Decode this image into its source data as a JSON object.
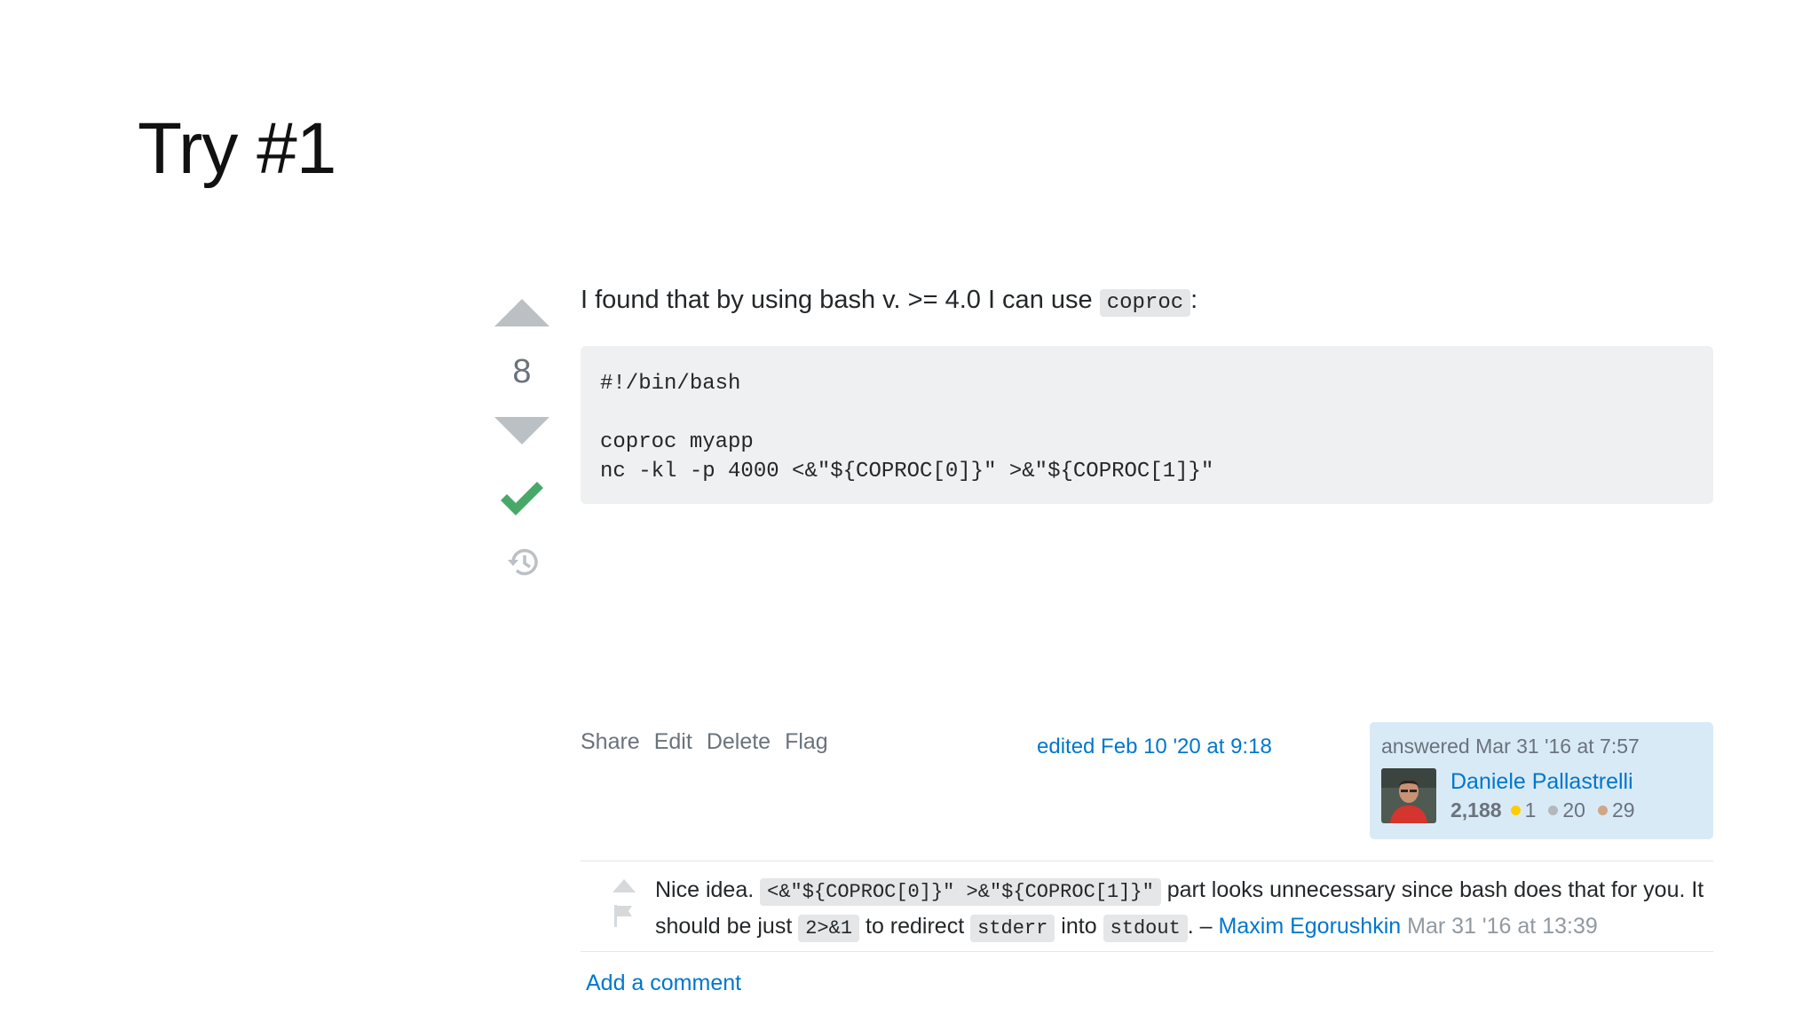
{
  "slide": {
    "title": "Try #1"
  },
  "vote": {
    "count": "8"
  },
  "post": {
    "intro_text": "I found that by using bash v. >= 4.0 I can use",
    "intro_code": "coproc",
    "intro_colon": ":",
    "code_lines": [
      "#!/bin/bash",
      "",
      "coproc myapp",
      "nc -kl -p 4000 <&\"${COPROC[0]}\" >&\"${COPROC[1]}\""
    ]
  },
  "menu": {
    "share": "Share",
    "edit": "Edit",
    "delete": "Delete",
    "flag": "Flag"
  },
  "edited": {
    "text": "edited Feb 10 '20 at 9:18"
  },
  "user_card": {
    "answered": "answered Mar 31 '16 at 7:57",
    "name": "Daniele Pallastrelli",
    "reputation": "2,188",
    "badges": [
      {
        "count": "1",
        "color": "#ffcc01"
      },
      {
        "count": "20",
        "color": "#b4b8bc"
      },
      {
        "count": "29",
        "color": "#d1a684"
      }
    ]
  },
  "comment": {
    "text_1": "Nice idea.",
    "code_1": "<&\"${COPROC[0]}\" >&\"${COPROC[1]}\"",
    "text_2": "part looks unnecessary since bash does that for you. It should be just",
    "code_2": "2>&1",
    "text_3": "to redirect",
    "code_3": "stderr",
    "text_4": "into",
    "code_4": "stdout",
    "text_5": ". –",
    "author": "Maxim Egorushkin",
    "date": "Mar 31 '16 at 13:39"
  },
  "add_comment": "Add a comment",
  "colors": {
    "link": "#0077cc",
    "accepted": "#48a868",
    "vote_arrow": "#bbc0c4",
    "user_card_bg": "#d9eaf7"
  },
  "icons": [
    "upvote-arrow-icon",
    "downvote-arrow-icon",
    "accepted-check-icon",
    "history-icon",
    "comment-upvote-icon",
    "flag-icon",
    "avatar"
  ]
}
